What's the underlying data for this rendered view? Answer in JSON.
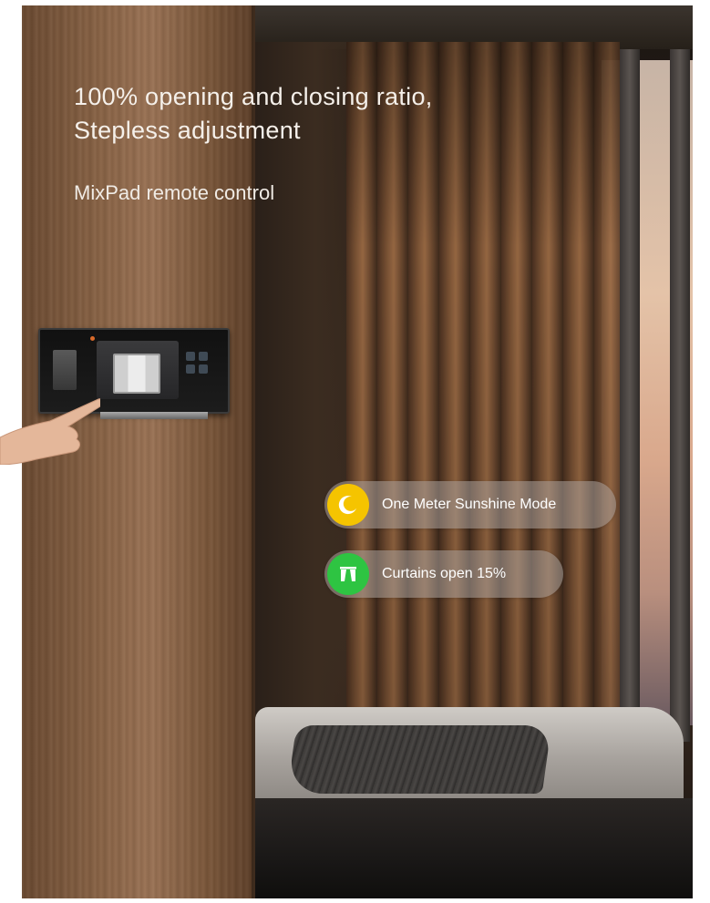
{
  "headline": {
    "line1": "100% opening and closing ratio,",
    "line2": "Stepless adjustment"
  },
  "subheadline": "MixPad remote control",
  "status_pills": [
    {
      "icon": "moon-icon",
      "icon_color": "#f5c400",
      "label": "One Meter Sunshine Mode"
    },
    {
      "icon": "curtain-icon",
      "icon_color": "#2ec442",
      "label": "Curtains open 15%"
    }
  ]
}
